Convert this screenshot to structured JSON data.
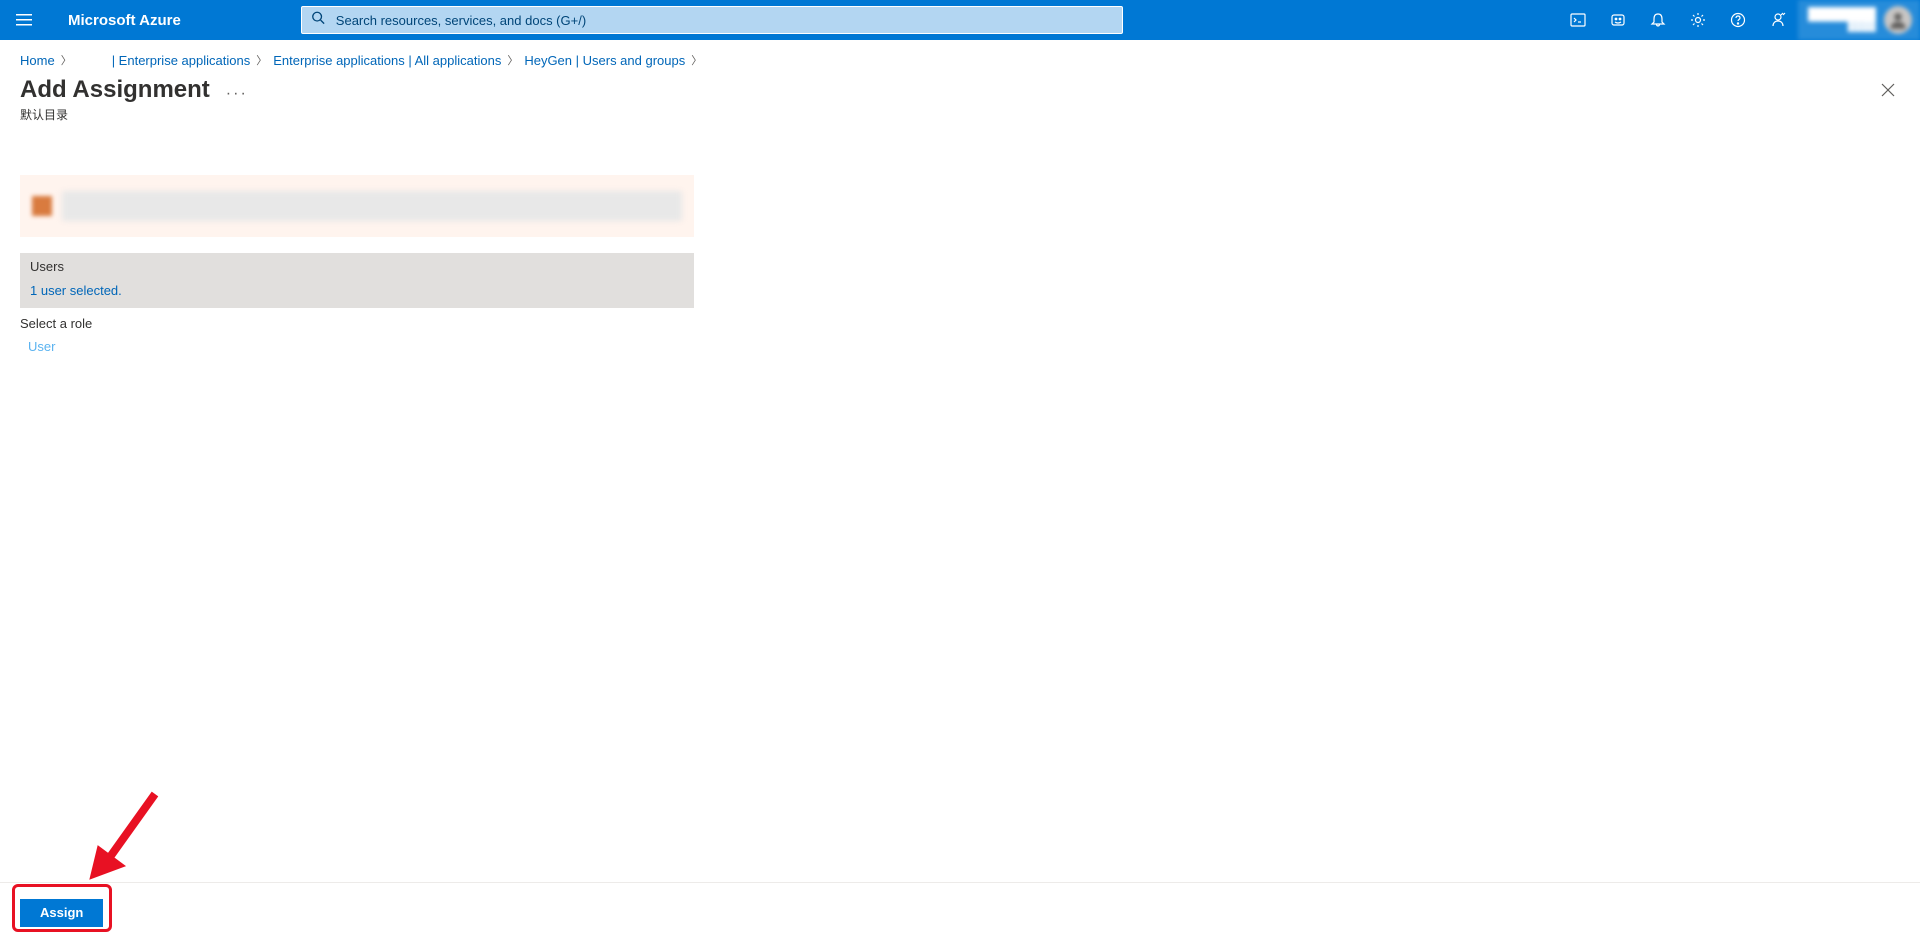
{
  "header": {
    "brand": "Microsoft Azure",
    "search_placeholder": "Search resources, services, and docs (G+/)"
  },
  "breadcrumb": {
    "items": [
      {
        "label": "Home"
      },
      {
        "label": "       ",
        "blurred": true
      },
      {
        "label": " | Enterprise applications",
        "prefix": true
      },
      {
        "label": "Enterprise applications | All applications"
      },
      {
        "label": "HeyGen | Users and groups"
      }
    ]
  },
  "page": {
    "title": "Add Assignment",
    "subtitle": "默认目录"
  },
  "form": {
    "info_text": " ",
    "users_label": "Users",
    "users_value": "1 user selected.",
    "role_label": "Select a role",
    "role_value": "User"
  },
  "footer": {
    "assign_label": "Assign"
  }
}
